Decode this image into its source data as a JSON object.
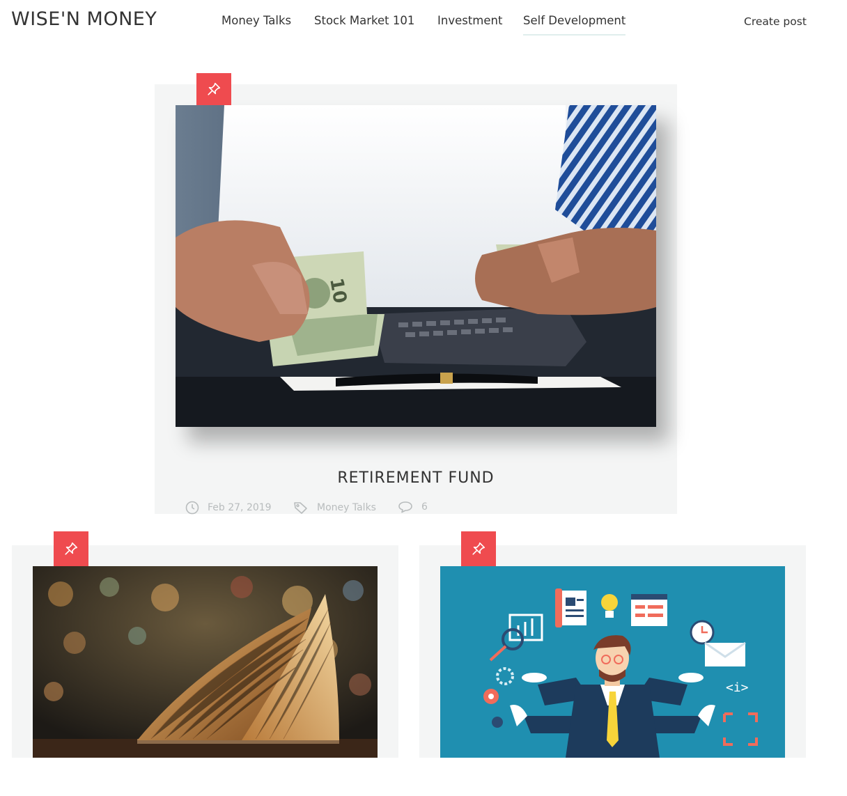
{
  "brand": "WISE'N MONEY",
  "nav": {
    "items": [
      {
        "label": "Money Talks"
      },
      {
        "label": "Stock Market 101"
      },
      {
        "label": "Investment"
      },
      {
        "label": "Self Development"
      }
    ],
    "active": "Self Development",
    "create_post": "Create post"
  },
  "posts": [
    {
      "title": "RETIREMENT FUND",
      "date": "Feb 27, 2019",
      "category": "Money Talks",
      "comments": "6",
      "image": "hands-counting-dollar-bills"
    },
    {
      "image": "open-book-library"
    },
    {
      "image": "multitasking-businessman-illustration"
    }
  ],
  "colors": {
    "accent": "#ef4b4f",
    "card_bg": "#f4f5f5",
    "meta": "#b8bcbd"
  },
  "icons": {
    "pin": "pin-icon",
    "clock": "clock-icon",
    "tag": "tag-icon",
    "comment": "comment-icon"
  }
}
